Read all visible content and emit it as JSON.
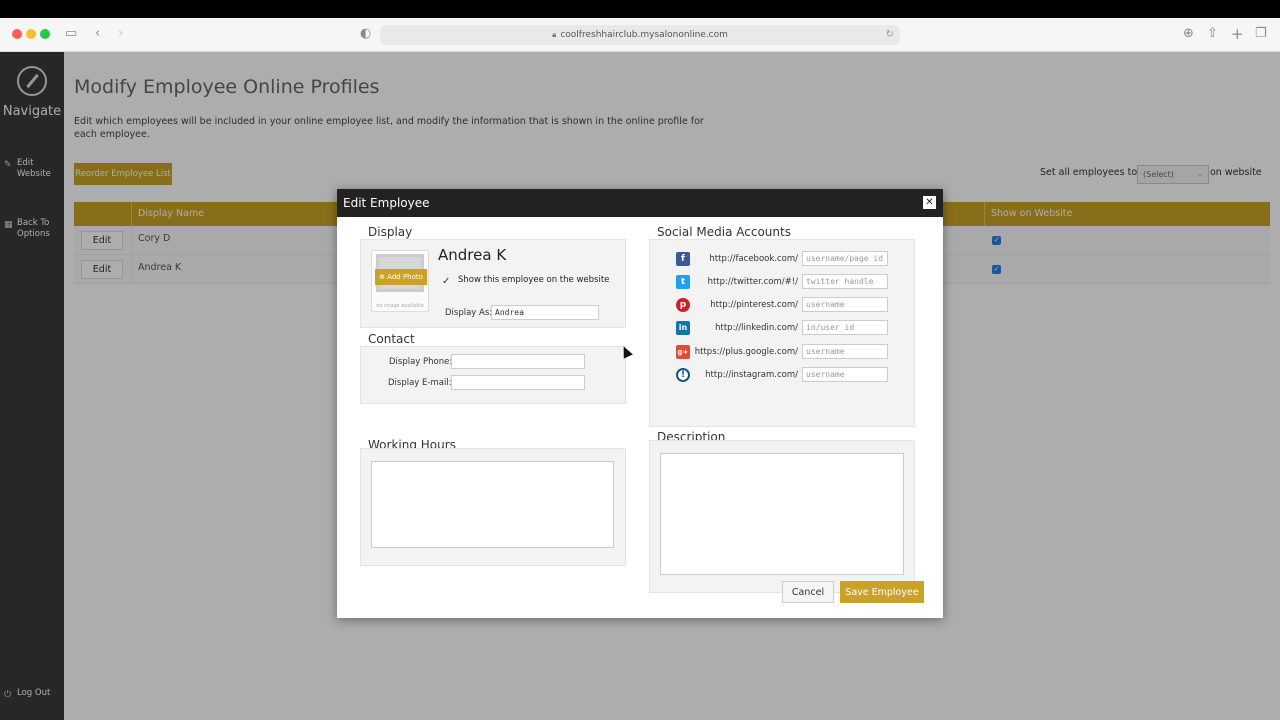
{
  "browser": {
    "url": "coolfreshhairclub.mysalononline.com"
  },
  "sidebar": {
    "navigate_label": "Navigate",
    "items": [
      {
        "label_line1": "Edit",
        "label_line2": "Website",
        "icon": "pencil-icon"
      },
      {
        "label_line1": "Back To",
        "label_line2": "Options",
        "icon": "grid-icon"
      },
      {
        "label_line1": "Log Out",
        "label_line2": "",
        "icon": "power-icon"
      }
    ]
  },
  "main": {
    "title": "Modify Employee Online Profiles",
    "description": "Edit which employees will be included in your online employee list, and modify the information that is shown in the online profile for each employee.",
    "reorder_label": "Reorder Employee List",
    "set_all_prefix": "Set all employees to",
    "set_all_value": "(Select)",
    "set_all_suffix": "on website",
    "table": {
      "headers": {
        "display_name": "Display Name",
        "show_on_website": "Show on Website"
      },
      "rows": [
        {
          "edit_label": "Edit",
          "name": "Cory D",
          "show": true
        },
        {
          "edit_label": "Edit",
          "name": "Andrea K",
          "show": true
        }
      ]
    }
  },
  "modal": {
    "title": "Edit Employee",
    "display": {
      "section_title": "Display",
      "employee_name": "Andrea K",
      "add_photo_label": "Add Photo",
      "no_image_text": "no image available",
      "show_label": "Show this employee on the website",
      "display_as_label": "Display As:",
      "display_as_value": "Andrea"
    },
    "contact": {
      "section_title": "Contact",
      "phone_label": "Display Phone:",
      "email_label": "Display E-mail:"
    },
    "working_hours": {
      "section_title": "Working Hours"
    },
    "social": {
      "section_title": "Social Media Accounts",
      "accounts": [
        {
          "icon": "facebook-icon",
          "glyph": "f",
          "color": "#3b5998",
          "url": "http://facebook.com/",
          "placeholder": "username/page id"
        },
        {
          "icon": "twitter-icon",
          "glyph": "t",
          "color": "#1da1f2",
          "url": "http://twitter.com/#!/",
          "placeholder": "twitter handle"
        },
        {
          "icon": "pinterest-icon",
          "glyph": "p",
          "color": "#cb2027",
          "url": "http://pinterest.com/",
          "placeholder": "username"
        },
        {
          "icon": "linkedin-icon",
          "glyph": "in",
          "color": "#0e76a8",
          "url": "http://linkedin.com/",
          "placeholder": "in/user id"
        },
        {
          "icon": "google-plus-icon",
          "glyph": "g+",
          "color": "#dd4b39",
          "url": "https://plus.google.com/",
          "placeholder": "username"
        },
        {
          "icon": "instagram-icon",
          "glyph": "!",
          "color": "#125688",
          "url": "http://instagram.com/",
          "placeholder": "username"
        }
      ]
    },
    "description": {
      "section_title": "Description"
    },
    "cancel_label": "Cancel",
    "save_label": "Save Employee"
  }
}
